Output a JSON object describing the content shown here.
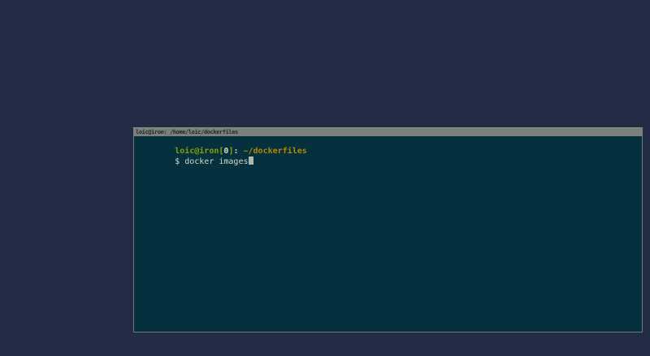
{
  "desktop": {
    "background_color": "#232c44"
  },
  "window": {
    "title": "loic@iron: /home/loic/dockerfiles",
    "titlebar_bg": "#79817a",
    "title_text_color": "#1e2733",
    "border_color": "#6e7a78"
  },
  "terminal": {
    "background_color": "#04313d",
    "colors": {
      "prompt_green": "#87a200",
      "path_yellow": "#b58900",
      "foreground": "#cfd8cc",
      "cursor": "#aab8ae"
    },
    "prompt": {
      "user_host": "loic@iron",
      "bracket_open": "[",
      "exit_status": "0",
      "bracket_close": "]",
      "separator": ": ",
      "path": "~/dockerfiles"
    },
    "command_line": {
      "prompt_symbol": "$ ",
      "command": "docker images"
    }
  }
}
